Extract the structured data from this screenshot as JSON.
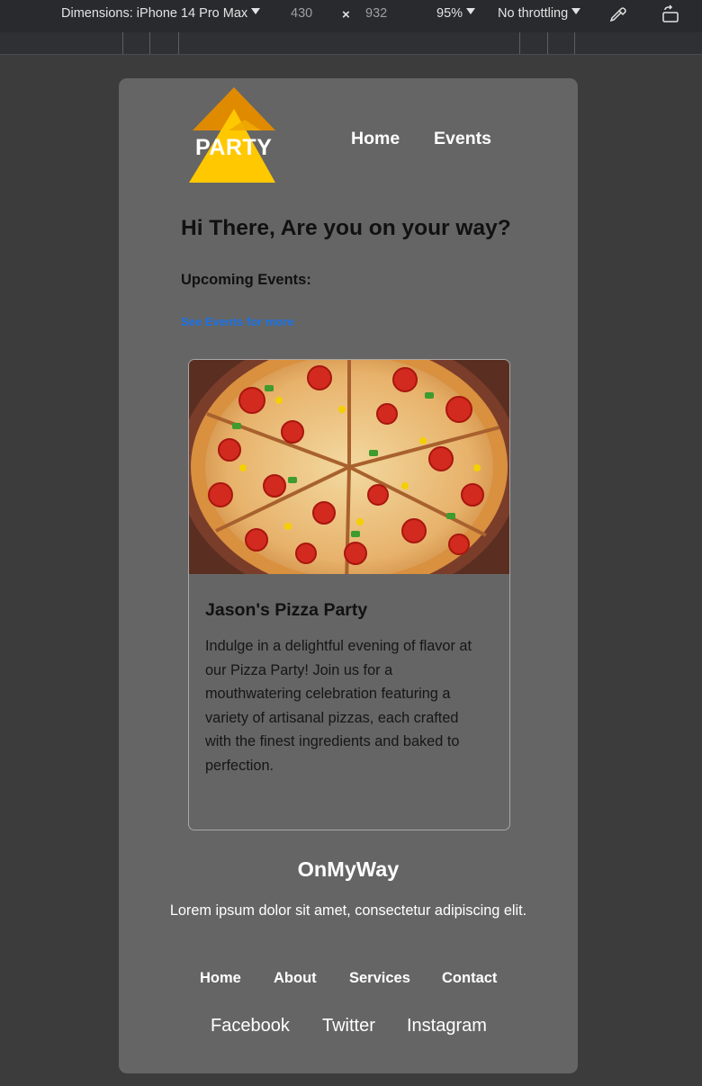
{
  "devtools": {
    "dimensions_label": "Dimensions: iPhone 14 Pro Max",
    "width": "430",
    "separator": "×",
    "height": "932",
    "zoom": "95%",
    "throttling": "No throttling"
  },
  "header": {
    "logo_text": "PARTY",
    "nav": [
      "Home",
      "Events"
    ]
  },
  "main": {
    "greeting": "Hi There, Are you on your way?",
    "upcoming_heading": "Upcoming Events:",
    "see_more_link": "See Events for more"
  },
  "event_card": {
    "image": "pizza-photo",
    "title": "Jason's Pizza Party",
    "description": "Indulge in a delightful evening of flavor at our Pizza Party! Join us for a mouthwatering celebration featuring a variety of artisanal pizzas, each crafted with the finest ingredients and baked to perfection."
  },
  "footer": {
    "brand": "OnMyWay",
    "tagline": "Lorem ipsum dolor sit amet, consectetur adipiscing elit.",
    "nav": [
      "Home",
      "About",
      "Services",
      "Contact"
    ],
    "social": [
      "Facebook",
      "Twitter",
      "Instagram"
    ]
  },
  "colors": {
    "page_background": "#3c3c3c",
    "panel_background": "#656565",
    "logo_yellow": "#ffc800",
    "logo_orange": "#e08a00",
    "link_blue": "#1a73e8"
  }
}
